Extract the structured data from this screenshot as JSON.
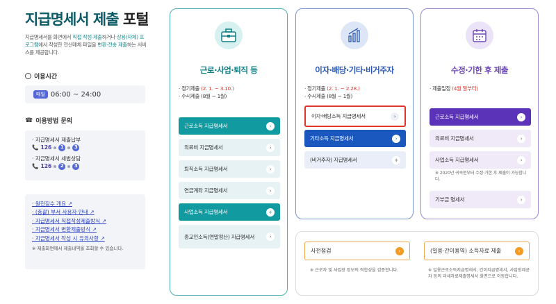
{
  "header": {
    "title_a": "지급명세서 제출",
    "title_b": "포털",
    "intro_1": "지급명세서를 화면에서",
    "intro_hl1": "직접 작성·제출",
    "intro_2": "하거나",
    "intro_hl2": "상용(자체) 프로그램",
    "intro_3": "에서 작성한 전산매체 파일을",
    "intro_hl3": "변환·전송 제출",
    "intro_4": "하는 서비스를 제공합니다."
  },
  "usage": {
    "heading": "이용시간",
    "badge": "매일",
    "time": "06:00 ~ 24:00"
  },
  "inquiry": {
    "heading": "이용방법 문의",
    "items": [
      {
        "label": "· 지급명세서 제출납부",
        "phone": "126",
        "d1": "1",
        "d2": "3"
      },
      {
        "label": "· 지급명세서 세법상담",
        "phone": "126",
        "d1": "2",
        "d2": "3"
      }
    ]
  },
  "links": {
    "items": [
      "· 원천징수 개요 ↗",
      "· (충괄) 부서 사용자 안내 ↗",
      "· 지급명세서 직접작성제출방식 ↗",
      "· 지급명세서 변환제출방식 ↗",
      "· 지급명세서 작성 시 유의사항 ↗"
    ],
    "note": "※ 제출화면에서 제출내역을 조회할 수 있습니다."
  },
  "card1": {
    "title": "근로·사업·퇴직 등",
    "sched_1": "· 정기제출",
    "sched_1r": "(2. 1. ~ 3.10.)",
    "sched_2": "· 수시제출 (8월 ~ 1월)",
    "buttons": [
      "근로소득 지급명세서",
      "의료비 지급명세서",
      "퇴직소득 지급명세서",
      "연금계좌 지급명세서",
      "사업소득 지급명세서",
      "종교인소득(연말정산) 지급명세서"
    ]
  },
  "card2": {
    "title": "이자·배당·기타·비거주자",
    "sched_1": "· 정기제출",
    "sched_1r": "(2. 1. ~ 2.28.)",
    "sched_2": "· 수시제출 (8월 ~ 1월)",
    "buttons": [
      "이자·배당소득 지급명세서",
      "기타소득 지급명세서",
      "(비거주자) 지급명세서"
    ]
  },
  "card3": {
    "title": "수정·기한 후 제출",
    "sched_1": "· 제출일정",
    "sched_1r": "(4월 말부터)",
    "buttons": [
      "근로소득 지급명세서",
      "의료비 지급명세서",
      "사업소득 지급명세서",
      "기부금 명세서"
    ],
    "note": "※ 2020년 귀속분부터 수정·기한 후 제출이 가능합니다."
  },
  "card4": {
    "btn1": "사전점검",
    "note1": "※ 근로자 및 사업장 정보의 적합성을 검증합니다.",
    "btn2": "(일용·간이용역) 소득자료 제출",
    "note2": "※ 일용근로소득지급명세서, 간이지급명세서, 사업장제공자 등의 과세자료제출명세서 화면으로 이동합니다."
  },
  "colors": {
    "teal": "#119aa0",
    "blue": "#1a58c0",
    "purple": "#5a33b8",
    "selected_border": "#e0352b"
  }
}
